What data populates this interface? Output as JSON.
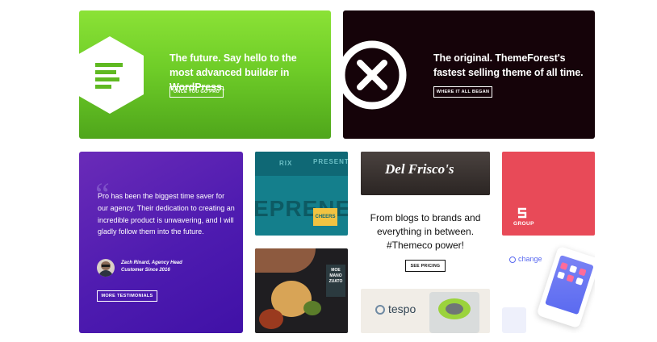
{
  "pro_card": {
    "headline": "The future. Say hello to the most advanced builder in WordPress.",
    "button_label": "ONCE YOU GO PRO",
    "accent": "#6fcd28"
  },
  "x_card": {
    "headline": "The original. ThemeForest's fastest selling theme of all time.",
    "button_label": "WHERE IT ALL BEGAN",
    "accent": "#150309"
  },
  "testimonial": {
    "quote": "Pro has been the biggest time saver for our agency. Their dedication to creating an incredible product is unwavering, and I will gladly follow them into the future.",
    "author_name": "Zach Rinard, Agency Head",
    "author_role": "Customer Since 2016",
    "button_label": "MORE TESTIMONIALS",
    "accent": "#4e1bb0"
  },
  "center_promo": {
    "headline": "From blogs to brands and everything in between. #Themeco power!",
    "button_label": "SEE PRICING"
  },
  "portfolio": {
    "teal_word_top": "RIX",
    "teal_word_top2": "PRESENT",
    "teal_word_main": "EPRENE",
    "teal_badge": "CHEERS",
    "food_label": "MOE MANO ZUATO",
    "defriscos_logo": "Del Frisco's",
    "tespo_logo": "tespo",
    "group_logo": "GROUP",
    "change_logo": "change"
  }
}
